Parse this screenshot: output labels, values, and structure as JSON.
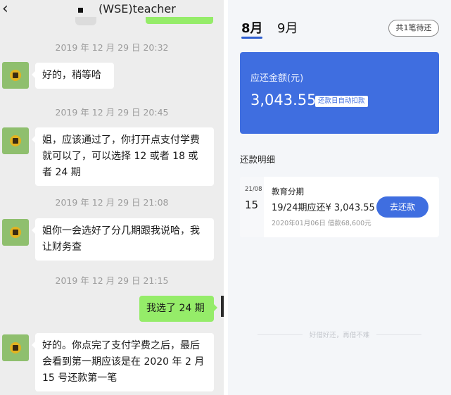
{
  "chat": {
    "title": "(WSE)teacher",
    "back_glyph": "‹",
    "messages": [
      {
        "time": "2019 年 12 月 29 日 20:32",
        "text": "好的，稍等哈"
      },
      {
        "time": "2019 年 12 月 29 日 20:45",
        "text": "姐，应该通过了，你打开点支付学费就可以了，可以选择 12 或者 18 或者 24 期"
      },
      {
        "time": "2019 年 12 月 29 日 21:08",
        "text": "姐你一会选好了分几期跟我说哈，我让财务查"
      },
      {
        "time": "2019 年 12 月 29 日 21:15",
        "text": "我选了 24 期"
      },
      {
        "time": "",
        "text": "好的。你点完了支付学费之后，最后会看到第一期应该是在 2020 年 2 月 15 号还款第一笔"
      }
    ]
  },
  "repay": {
    "tabs": [
      "8月",
      "9月"
    ],
    "pending": "共1笔待还",
    "card": {
      "label": "应还金额(元)",
      "amount": "3,043.55",
      "badge": "还款日自动扣款"
    },
    "section_title": "还款明细",
    "item": {
      "month_day": "21/08",
      "day": "15",
      "name": "教育分期",
      "term": "19/24期应还¥ 3,043.55",
      "meta": "2020年01月06日 借款68,600元",
      "button": "去还款"
    },
    "footer": "好借好还，再借不难"
  },
  "colors": {
    "chat_bg": "#ededed",
    "green_bubble": "#95ec69",
    "accent_blue": "#3f6ee0"
  },
  "icons": {
    "back": "chevron-left-icon",
    "avatar": "sunflower-avatar"
  }
}
